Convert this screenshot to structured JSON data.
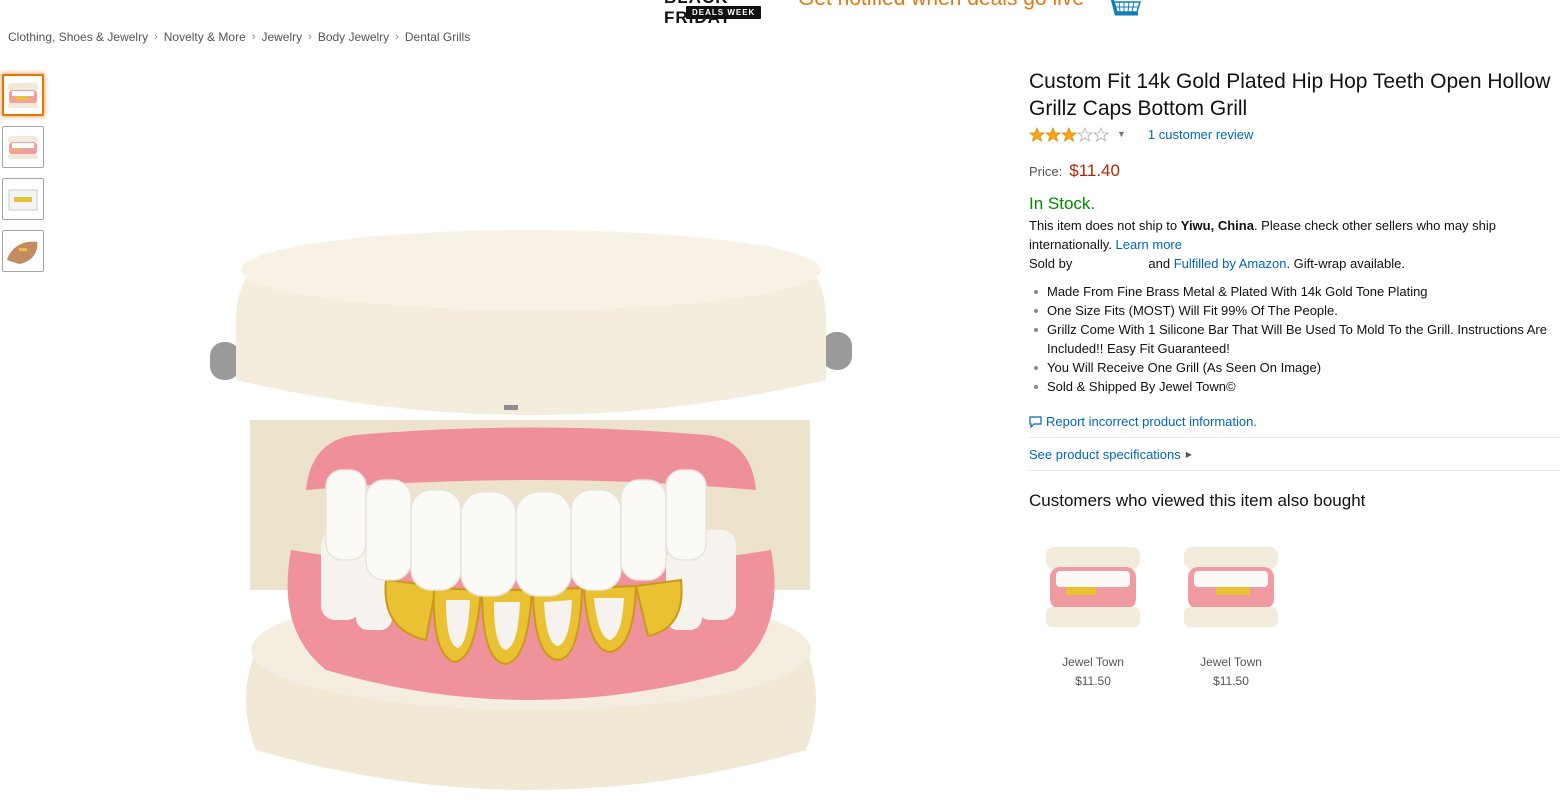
{
  "promo": {
    "logo_top": "BLACK FRIDAY",
    "logo_badge": "DEALS WEEK",
    "text": "Get notified when deals go live"
  },
  "breadcrumb": [
    "Clothing, Shoes & Jewelry",
    "Novelty & More",
    "Jewelry",
    "Body Jewelry",
    "Dental Grills"
  ],
  "thumbnails": [
    {
      "icon": "grill-front-thumb",
      "active": true
    },
    {
      "icon": "grill-angle-thumb",
      "active": false
    },
    {
      "icon": "grill-box-thumb",
      "active": false
    },
    {
      "icon": "grill-hand-thumb",
      "active": false
    }
  ],
  "product": {
    "title": "Custom Fit 14k Gold Plated Hip Hop Teeth Open Hollow Grillz Caps Bottom Grill",
    "rating_stars": 3,
    "rating_max": 5,
    "review_count_text": "1 customer review",
    "price_label": "Price:",
    "price": "$11.40",
    "stock": "In Stock.",
    "ship_prefix": "This item does not ship to ",
    "ship_location": "Yiwu, China",
    "ship_suffix": ". Please check other sellers who may ship internationally.",
    "learn_more": "Learn more",
    "sold_by": "Sold by",
    "and_text": "and",
    "fulfilled": "Fulfilled by Amazon",
    "gift_wrap": ". Gift-wrap available.",
    "bullets": [
      "Made From Fine Brass Metal & Plated With 14k Gold Tone Plating",
      "One Size Fits (MOST) Will Fit 99% Of The People.",
      "Grillz Come With 1 Silicone Bar That Will Be Used To Mold To the Grill. Instructions Are Included!! Easy Fit Guaranteed!",
      "You Will Receive One Grill (As Seen On Image)",
      "Sold & Shipped By Jewel Town©"
    ],
    "report_link": "Report incorrect product information.",
    "spec_link": "See product specifications"
  },
  "also_bought": {
    "heading": "Customers who viewed this item also bought",
    "items": [
      {
        "brand": "Jewel Town",
        "price": "$11.50"
      },
      {
        "brand": "Jewel Town",
        "price": "$11.50"
      }
    ]
  },
  "colors": {
    "accent_orange": "#e47911",
    "link_blue": "#0066c0",
    "price_red": "#b12704",
    "stock_green": "#008a00",
    "star_gold": "#ffa41c"
  }
}
